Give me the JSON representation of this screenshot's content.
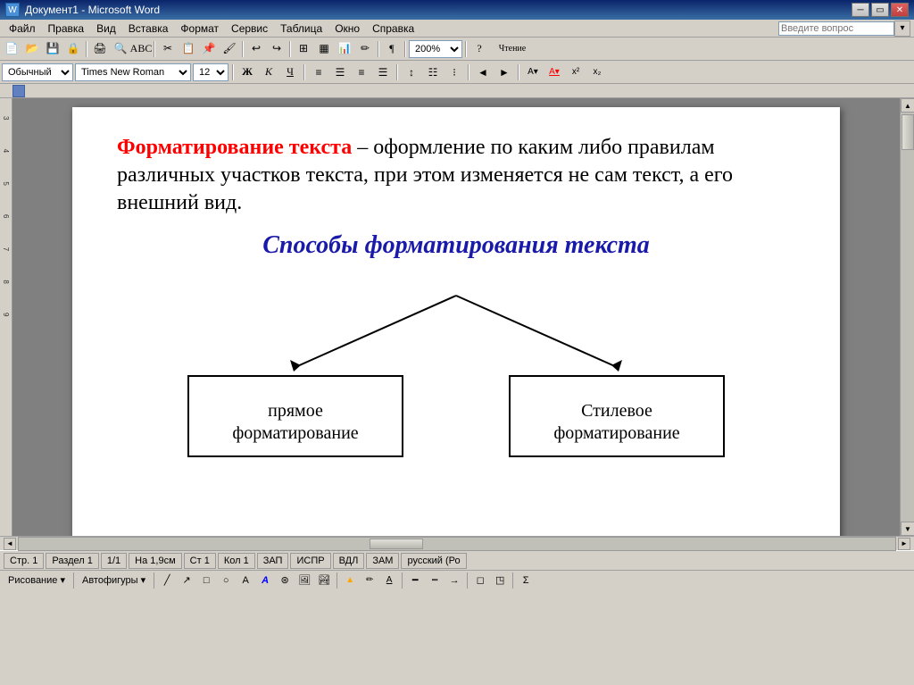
{
  "titleBar": {
    "title": "Документ1 - Microsoft Word",
    "minBtn": "🗕",
    "restoreBtn": "🗗",
    "closeBtn": "✕"
  },
  "menuBar": {
    "items": [
      "Файл",
      "Правка",
      "Вид",
      "Вставка",
      "Формат",
      "Сервис",
      "Таблица",
      "Окно",
      "Справка"
    ],
    "helpPlaceholder": "Введите вопрос"
  },
  "formattingToolbar": {
    "style": "Обычный",
    "font": "Times New Roman",
    "size": "12",
    "boldLabel": "Ж",
    "italicLabel": "К",
    "underlineLabel": "Ч",
    "zoomLabel": "200%"
  },
  "document": {
    "para1Part1": "Форматирование текста",
    "para1Part2": " – оформление по каким либо правилам различных участков текста, при этом изменяется не сам текст, а его внешний вид.",
    "heading": "Способы форматирования текста",
    "box1": "прямое форматирование",
    "box2": "Стилевое форматирование"
  },
  "statusBar": {
    "page": "Стр. 1",
    "section": "Раздел 1",
    "pageOf": "1/1",
    "position": "На 1,9см",
    "line": "Ст 1",
    "col": "Кол 1",
    "zap": "ЗАП",
    "ispr": "ИСПР",
    "vdl": "ВДЛ",
    "zam": "ЗАМ",
    "lang": "русский (Ро"
  },
  "drawToolbar": {
    "drawLabel": "Рисование ▾",
    "autoLabel": "Автофигуры ▾"
  }
}
